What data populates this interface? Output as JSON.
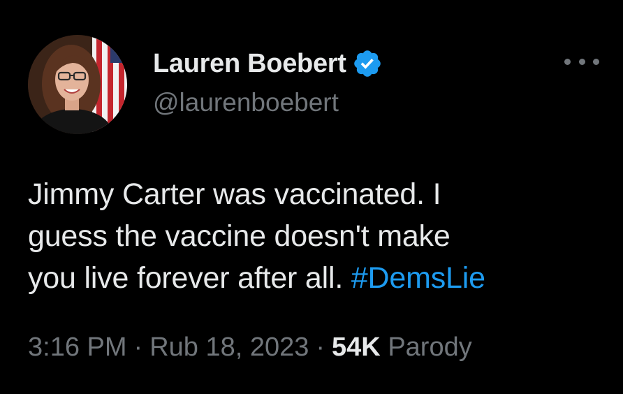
{
  "tweet": {
    "display_name": "Lauren Boebert",
    "handle": "@laurenboebert",
    "text_line1": "Jimmy Carter was vaccinated. I",
    "text_line2": "guess the vaccine doesn't make",
    "text_line3": "you live forever after all.",
    "hashtag": "#DemsLie",
    "time": "3:16 PM",
    "separator": "·",
    "date": "Rub 18, 2023",
    "views": "54K",
    "views_suffix": "Parody"
  },
  "icons": {
    "verified": "verified-badge-icon",
    "more": "more-options-icon"
  },
  "colors": {
    "background": "#000000",
    "primary_text": "#e7e9ea",
    "secondary_text": "#71767b",
    "accent": "#1d9bf0"
  }
}
